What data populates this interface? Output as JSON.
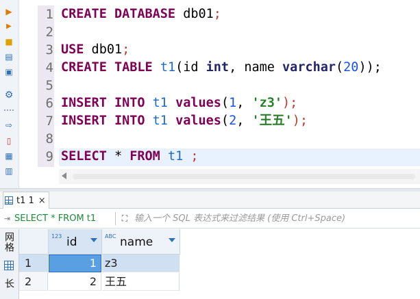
{
  "editor": {
    "line_numbers": [
      "1",
      "2",
      "3",
      "4",
      "5",
      "6",
      "7",
      "8",
      "9"
    ],
    "lines": [
      [
        {
          "t": "CREATE",
          "c": "kw"
        },
        {
          "t": " ",
          "c": "par"
        },
        {
          "t": "DATABASE",
          "c": "kw"
        },
        {
          "t": " db01",
          "c": "par"
        },
        {
          "t": ";",
          "c": "pun"
        }
      ],
      [],
      [
        {
          "t": "USE",
          "c": "kw"
        },
        {
          "t": " db01",
          "c": "par"
        },
        {
          "t": ";",
          "c": "pun"
        }
      ],
      [
        {
          "t": "CREATE",
          "c": "kw"
        },
        {
          "t": " ",
          "c": "par"
        },
        {
          "t": "TABLE",
          "c": "kw"
        },
        {
          "t": " ",
          "c": "par"
        },
        {
          "t": "t1",
          "c": "tbl"
        },
        {
          "t": "(id ",
          "c": "par"
        },
        {
          "t": "int",
          "c": "ty"
        },
        {
          "t": ", name ",
          "c": "par"
        },
        {
          "t": "varchar",
          "c": "ty"
        },
        {
          "t": "(",
          "c": "par"
        },
        {
          "t": "20",
          "c": "num"
        },
        {
          "t": "));",
          "c": "par"
        }
      ],
      [],
      [
        {
          "t": "INSERT",
          "c": "kw"
        },
        {
          "t": " ",
          "c": "par"
        },
        {
          "t": "INTO",
          "c": "kw"
        },
        {
          "t": " ",
          "c": "par"
        },
        {
          "t": "t1",
          "c": "tbl"
        },
        {
          "t": " ",
          "c": "par"
        },
        {
          "t": "values",
          "c": "kw"
        },
        {
          "t": "(",
          "c": "par"
        },
        {
          "t": "1",
          "c": "num"
        },
        {
          "t": ", ",
          "c": "par"
        },
        {
          "t": "'z3'",
          "c": "str"
        },
        {
          "t": ");",
          "c": "pun"
        }
      ],
      [
        {
          "t": "INSERT",
          "c": "kw"
        },
        {
          "t": " ",
          "c": "par"
        },
        {
          "t": "INTO",
          "c": "kw"
        },
        {
          "t": " ",
          "c": "par"
        },
        {
          "t": "t1",
          "c": "tbl"
        },
        {
          "t": " ",
          "c": "par"
        },
        {
          "t": "values",
          "c": "kw"
        },
        {
          "t": "(",
          "c": "par"
        },
        {
          "t": "2",
          "c": "num"
        },
        {
          "t": ", ",
          "c": "par"
        },
        {
          "t": "'王五'",
          "c": "str"
        },
        {
          "t": ");",
          "c": "pun"
        }
      ],
      [],
      [
        {
          "t": "SELECT",
          "c": "kw"
        },
        {
          "t": " * ",
          "c": "par"
        },
        {
          "t": "FROM",
          "c": "kw"
        },
        {
          "t": " ",
          "c": "par"
        },
        {
          "t": "t1",
          "c": "tbl"
        },
        {
          "t": " ",
          "c": "par"
        },
        {
          "t": ";",
          "c": "pun"
        }
      ]
    ],
    "toolbar_icons": [
      "execute-icon",
      "execute-script-icon",
      "explain-plan-icon",
      "load-plan-icon",
      "console-icon",
      "settings-icon",
      "export-icon",
      "new-script-icon",
      "format-icon",
      "outline-icon"
    ]
  },
  "result": {
    "tab_label": "t1 1",
    "tab_close": "×",
    "query_text": "SELECT * FROM t1",
    "filter_placeholder": "输入一个 SQL 表达式来过滤结果 (使用 Ctrl+Space)",
    "side_tabs": [
      "网格",
      "长"
    ],
    "columns": [
      {
        "type_badge": "123",
        "label": "id"
      },
      {
        "type_badge": "ABC",
        "label": "name"
      }
    ],
    "rows": [
      {
        "num": "1",
        "id": "1",
        "name": "z3",
        "selected": true
      },
      {
        "num": "2",
        "id": "2",
        "name": "王五",
        "selected": false
      }
    ]
  },
  "colors": {
    "keyword": "#7f0055",
    "table_name": "#1b6bc4",
    "string": "#2a7f2a",
    "number": "#1750eb",
    "selected_cell": "#5b9fe3",
    "current_line": "#e8f2fe"
  }
}
